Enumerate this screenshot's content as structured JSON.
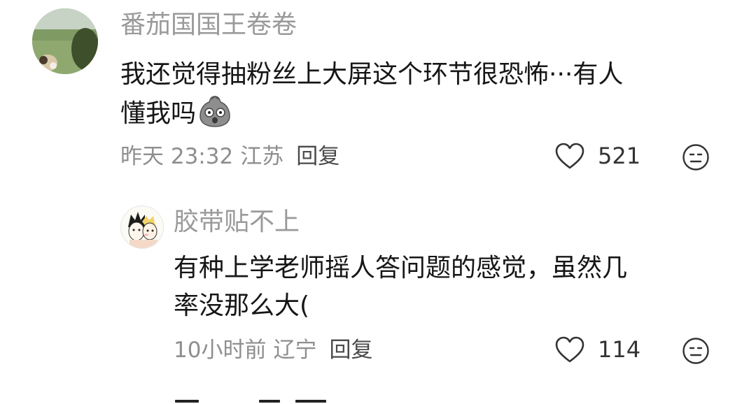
{
  "comments": [
    {
      "username": "番茄国国王卷卷",
      "text_line1": "我还觉得抽粉丝上大屏这个环节很恐怖···有人",
      "text_line2": "懂我吗",
      "emoji": "shocked-blob-emoji",
      "time": "昨天 23:32",
      "location": "江苏",
      "reply_label": "回复",
      "likes": "521"
    },
    {
      "username": "胶带贴不上",
      "text_line1": "有种上学老师摇人答问题的感觉，虽然几",
      "text_line2": "率没那么大(",
      "time": "10小时前",
      "location": "辽宁",
      "reply_label": "回复",
      "likes": "114"
    }
  ],
  "icons": {
    "like": "heart-outline-icon",
    "dislike": "frown-face-icon"
  },
  "colors": {
    "username": "#9a9a9a",
    "text": "#161616",
    "meta": "#8e8e8e",
    "icon": "#333333"
  }
}
